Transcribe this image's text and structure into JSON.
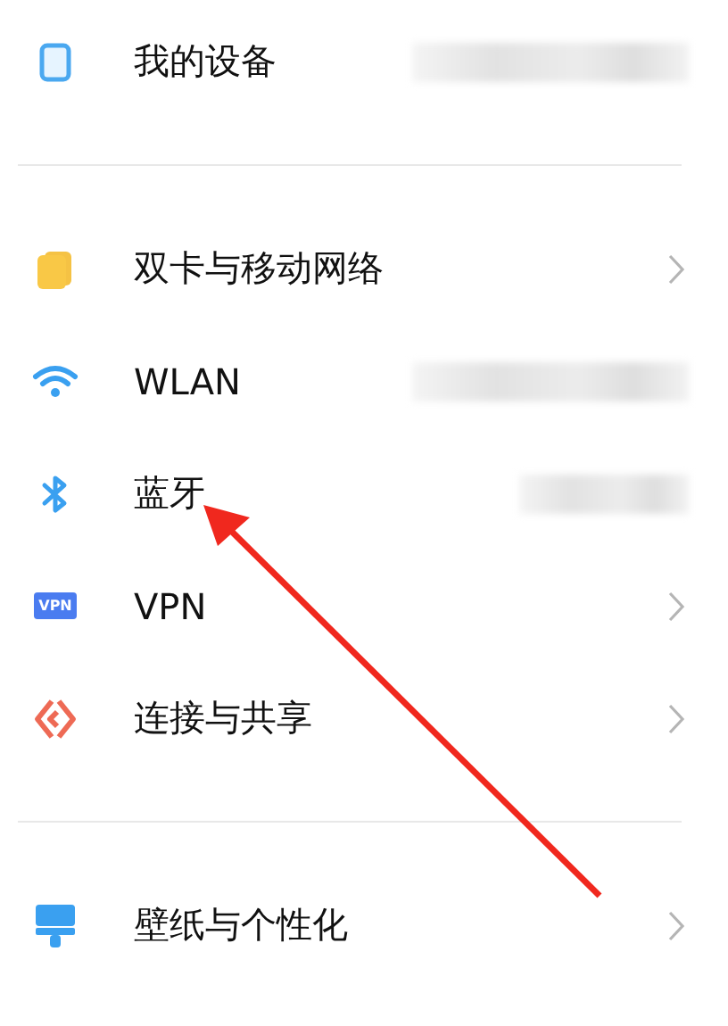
{
  "sections": [
    {
      "items": [
        {
          "label": "我的设备",
          "kind": "blurred"
        }
      ]
    },
    {
      "items": [
        {
          "label": "双卡与移动网络",
          "kind": "chevron"
        },
        {
          "label": "WLAN",
          "kind": "blurred"
        },
        {
          "label": "蓝牙",
          "kind": "blurred"
        },
        {
          "label": "VPN",
          "kind": "chevron"
        },
        {
          "label": "连接与共享",
          "kind": "chevron"
        }
      ]
    },
    {
      "items": [
        {
          "label": "壁纸与个性化",
          "kind": "chevron"
        }
      ]
    }
  ],
  "vpn_badge": "VPN"
}
